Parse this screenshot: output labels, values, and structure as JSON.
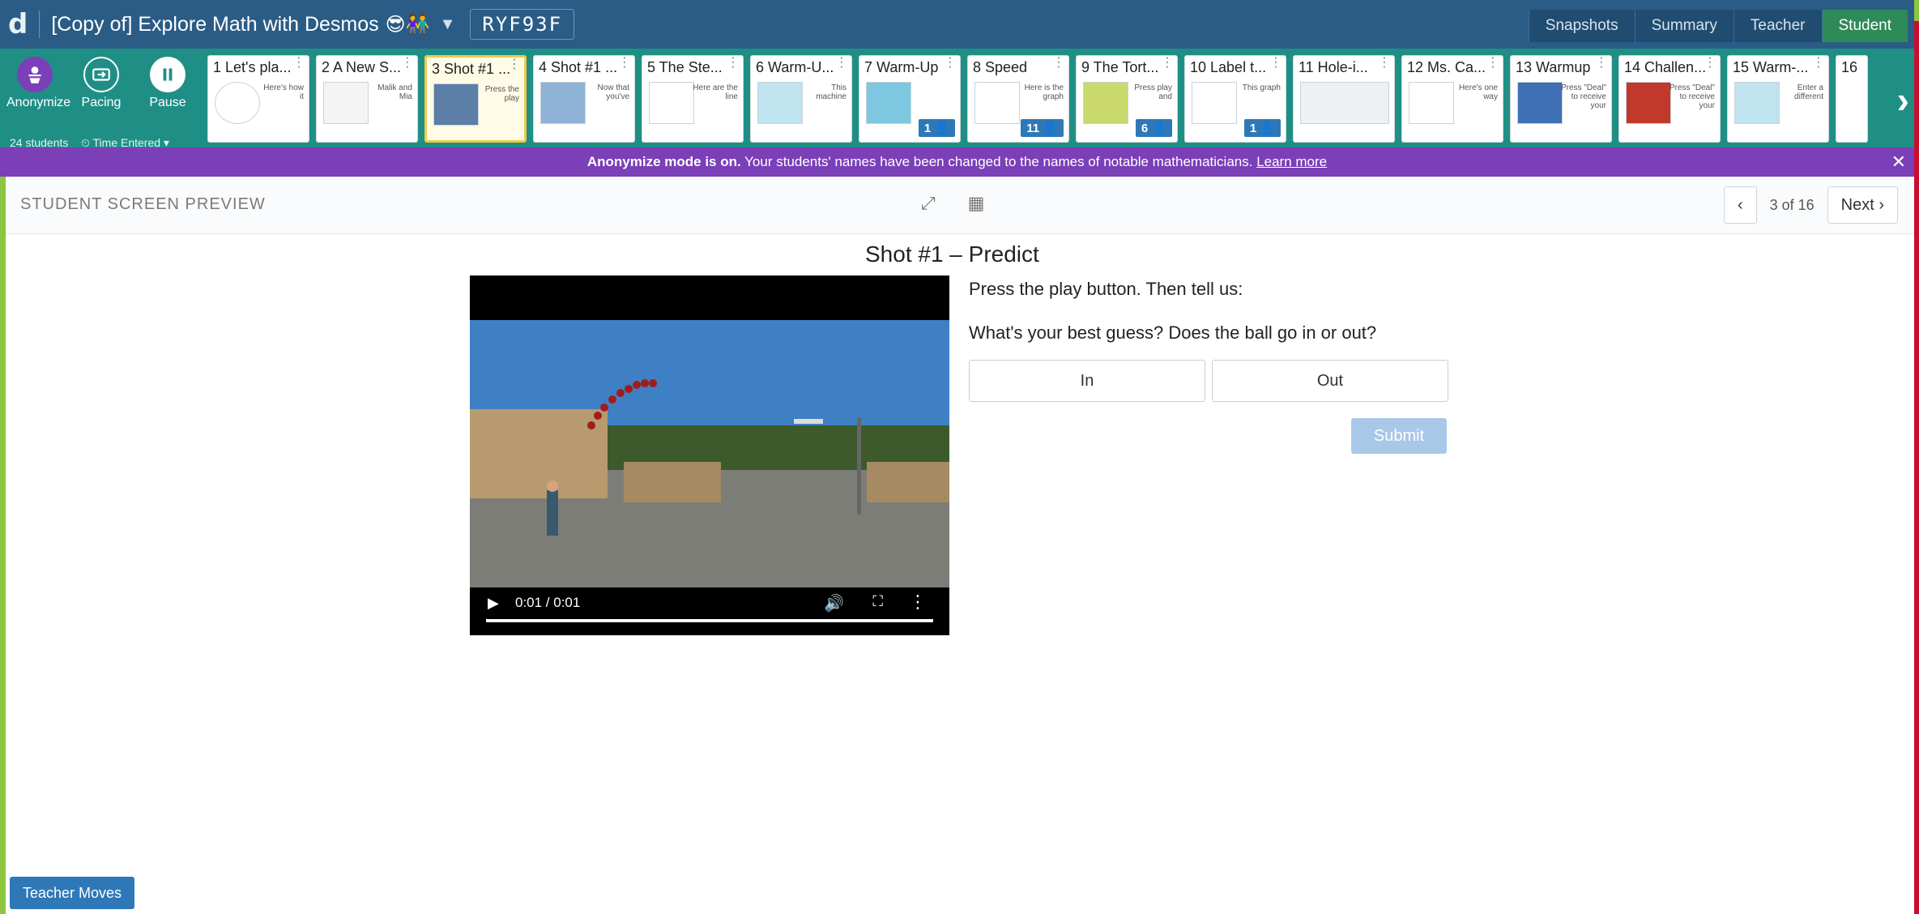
{
  "app": {
    "logo": "d",
    "activity_title": "[Copy of] Explore Math with Desmos",
    "title_emoji": "😎👫",
    "class_code": "RYF93F"
  },
  "view_tabs": [
    {
      "label": "Snapshots",
      "active": false
    },
    {
      "label": "Summary",
      "active": false
    },
    {
      "label": "Teacher",
      "active": false
    },
    {
      "label": "Student",
      "active": true
    }
  ],
  "controls": {
    "anonymize": "Anonymize",
    "pacing": "Pacing",
    "pause": "Pause",
    "students": "24 students",
    "sort": "⏲ Time Entered ▾"
  },
  "screens": [
    {
      "title": "1 Let's pla...",
      "snippet": "Here's how it",
      "badge": ""
    },
    {
      "title": "2 A New S...",
      "snippet": "Malik and Mia",
      "badge": ""
    },
    {
      "title": "3 Shot #1 ...",
      "snippet": "Press the play",
      "badge": ""
    },
    {
      "title": "4 Shot #1 ...",
      "snippet": "Now that you've",
      "badge": ""
    },
    {
      "title": "5 The Ste...",
      "snippet": "Here are the line",
      "badge": ""
    },
    {
      "title": "6 Warm-U...",
      "snippet": "This machine",
      "badge": ""
    },
    {
      "title": "7 Warm-Up",
      "snippet": "",
      "badge": "1 👤"
    },
    {
      "title": "8 Speed",
      "snippet": "Here is the graph",
      "badge": "11 👤"
    },
    {
      "title": "9 The Tort...",
      "snippet": "Press play and",
      "badge": "6 👤"
    },
    {
      "title": "10 Label t...",
      "snippet": "This graph",
      "badge": "1 👤"
    },
    {
      "title": "11 Hole-i...",
      "snippet": "",
      "badge": ""
    },
    {
      "title": "12 Ms. Ca...",
      "snippet": "Here's one way",
      "badge": ""
    },
    {
      "title": "13 Warmup",
      "snippet": "Press \"Deal\" to receive your",
      "badge": ""
    },
    {
      "title": "14 Challen...",
      "snippet": "Press \"Deal\" to receive your",
      "badge": ""
    },
    {
      "title": "15 Warm-...",
      "snippet": "Enter a different",
      "badge": ""
    },
    {
      "title": "16",
      "snippet": "",
      "badge": ""
    }
  ],
  "banner": {
    "strong": "Anonymize mode is on.",
    "text": " Your students' names have been changed to the names of notable mathematicians. ",
    "link": "Learn more",
    "close": "✕"
  },
  "preview": {
    "label": "STUDENT SCREEN PREVIEW",
    "expand_icon": "⤢",
    "calculator_icon": "▦",
    "prev": "‹",
    "count": "3 of 16",
    "next": "Next ›"
  },
  "screen": {
    "title": "Shot #1 – Predict",
    "prompt_1": "Press the play button. Then tell us:",
    "prompt_2": "What's your best guess? Does the ball go in or out?",
    "choice_in": "In",
    "choice_out": "Out",
    "submit": "Submit"
  },
  "video": {
    "time": "0:01 / 0:01",
    "progress": 1.0
  },
  "footer": {
    "teacher_moves": "Teacher Moves"
  },
  "colors": {
    "topbar": "#2a5c86",
    "dashbar": "#1f8f86",
    "banner": "#7b3fb8",
    "accent_blue": "#2f78b7",
    "student_tab": "#2e8b57"
  }
}
